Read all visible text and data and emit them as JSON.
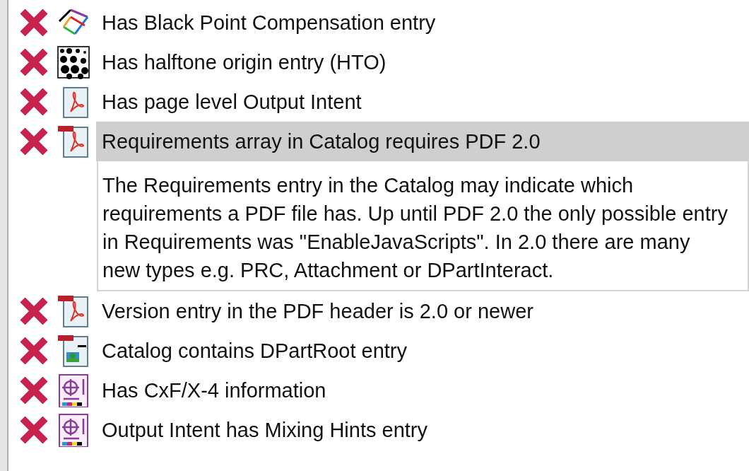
{
  "checks": [
    {
      "passed": false,
      "kind": "bpc",
      "label": "Has Black Point Compensation entry",
      "selected": false
    },
    {
      "passed": false,
      "kind": "halftone",
      "label": "Has halftone origin entry (HTO)",
      "selected": false
    },
    {
      "passed": false,
      "kind": "pdf",
      "label": "Has page level Output Intent",
      "selected": false
    },
    {
      "passed": false,
      "kind": "pdfflag",
      "label": "Requirements array in Catalog requires PDF 2.0",
      "selected": true,
      "description": "The Requirements entry in the Catalog may indicate which requirements a PDF file has. Up until PDF 2.0 the only possible entry in Requirements was \"EnableJavaScripts\". In 2.0 there are many new types e.g. PRC, Attachment or DPartInteract."
    },
    {
      "passed": false,
      "kind": "pdfflag",
      "label": "Version entry in the PDF header is 2.0 or newer",
      "selected": false
    },
    {
      "passed": false,
      "kind": "dpart",
      "label": "Catalog contains DPartRoot entry",
      "selected": false
    },
    {
      "passed": false,
      "kind": "cxf",
      "label": "Has CxF/X-4 information",
      "selected": false
    },
    {
      "passed": false,
      "kind": "cxf",
      "label": "Output Intent has Mixing Hints entry",
      "selected": false
    }
  ]
}
